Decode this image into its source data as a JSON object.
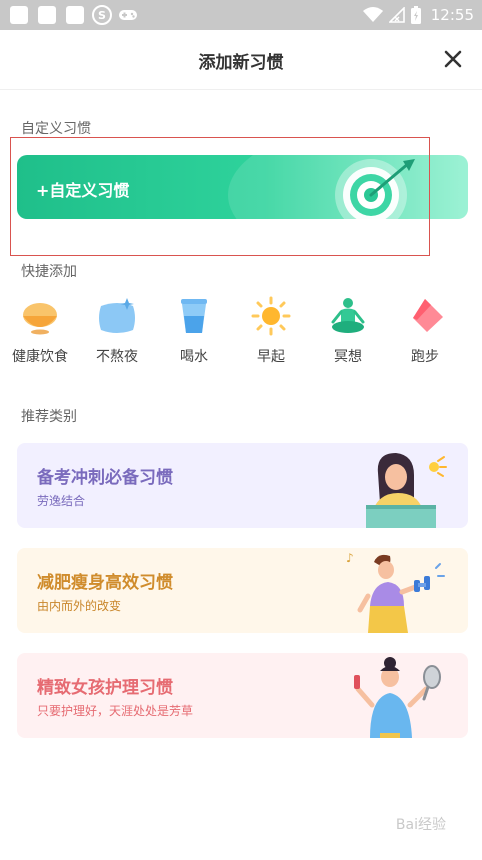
{
  "status_bar": {
    "s_glyph": "S",
    "time": "12:55"
  },
  "header": {
    "title": "添加新习惯",
    "close_icon": "close-icon"
  },
  "custom_section": {
    "label": "自定义习惯",
    "button_label": "+自定义习惯",
    "icon": "target-icon"
  },
  "quick_section": {
    "label": "快捷添加",
    "items": [
      {
        "label": "健康饮食",
        "icon": "bowl-icon"
      },
      {
        "label": "不熬夜",
        "icon": "pillow-icon"
      },
      {
        "label": "喝水",
        "icon": "cup-icon"
      },
      {
        "label": "早起",
        "icon": "sun-icon"
      },
      {
        "label": "冥想",
        "icon": "meditation-icon"
      },
      {
        "label": "跑步",
        "icon": "shoe-icon"
      }
    ]
  },
  "recommend_section": {
    "label": "推荐类别",
    "cards": [
      {
        "title": "备考冲刺必备习惯",
        "subtitle": "劳逸结合",
        "bg": "#f2f0ff",
        "title_color": "#7a6bbd",
        "sub_color": "#7a6bbd"
      },
      {
        "title": "减肥瘦身高效习惯",
        "subtitle": "由内而外的改变",
        "bg": "#fff7ea",
        "title_color": "#d08c2c",
        "sub_color": "#c9862a"
      },
      {
        "title": "精致女孩护理习惯",
        "subtitle": "只要护理好，天涯处处是芳草",
        "bg": "#fff1f2",
        "title_color": "#e66b72",
        "sub_color": "#e66b72"
      }
    ]
  },
  "watermark": "Bai经验",
  "colors": {
    "accent_green": "#2cc995",
    "status_bar": "#c8c8c8"
  }
}
